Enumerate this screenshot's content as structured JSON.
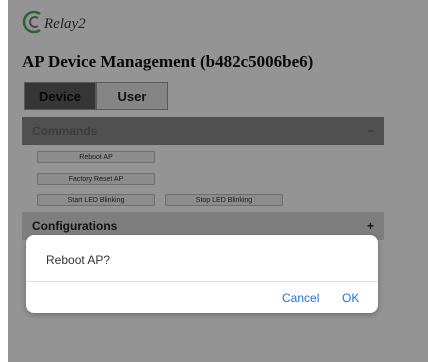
{
  "brand": {
    "name": "Relay2",
    "icon": "relay-logo-icon"
  },
  "header": {
    "title": "AP Device Management (b482c5006be6)"
  },
  "tabs": [
    {
      "label": "Device",
      "active": true
    },
    {
      "label": "User",
      "active": false
    }
  ],
  "commands": {
    "title": "Commands",
    "toggle": "−",
    "buttons": {
      "reboot": "Reboot AP",
      "factory_reset": "Factory Reset AP",
      "start_led": "Start LED Blinking",
      "stop_led": "Stop LED Blinking"
    }
  },
  "configurations": {
    "title": "Configurations",
    "toggle": "+"
  },
  "hidden_text": "c",
  "dialog": {
    "message": "Reboot AP?",
    "cancel_label": "Cancel",
    "ok_label": "OK"
  },
  "colors": {
    "link": "#1e73d6",
    "overlay": "rgba(0,0,0,0.42)",
    "brand_green": "#4caf50"
  }
}
